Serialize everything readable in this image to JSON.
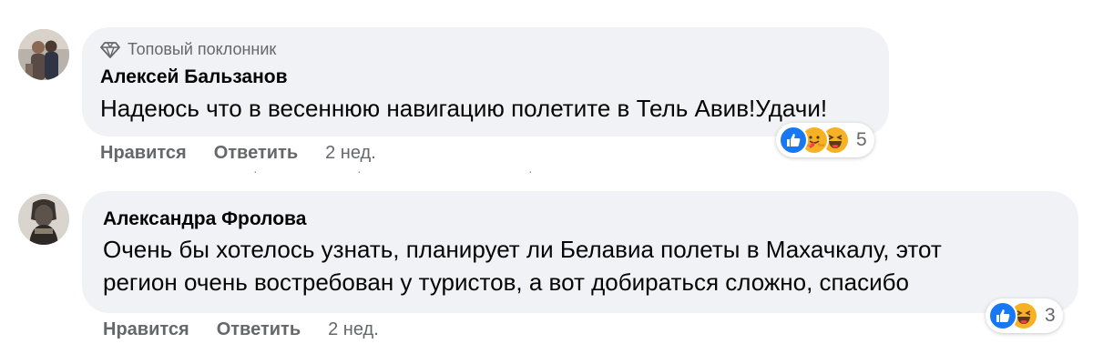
{
  "comments": [
    {
      "badge": "Топовый поклонник",
      "author": "Алексей Бальзанов",
      "text": "Надеюсь что в весеннюю навигацию полетите в Тель Авив!Удачи!",
      "actions": {
        "like": "Нравится",
        "reply": "Ответить",
        "time": "2 нед."
      },
      "reactions": {
        "types": [
          "like-icon",
          "care-icon",
          "haha-icon"
        ],
        "count": "5"
      }
    },
    {
      "author": "Александра Фролова",
      "text_line1": "Очень бы хотелось узнать, планирует ли Белавиа полеты в Махачкалу, этот",
      "text_line2": "регион очень востребован у туристов, а вот добираться сложно, спасибо",
      "actions": {
        "like": "Нравится",
        "reply": "Ответить",
        "time": "2 нед."
      },
      "reactions": {
        "types": [
          "like-icon",
          "haha-icon"
        ],
        "count": "3"
      }
    }
  ],
  "colors": {
    "bubble": "#f0f2f5",
    "muted": "#65676b",
    "like_blue": "#1877f2",
    "haha_yellow": "#f7b125"
  }
}
